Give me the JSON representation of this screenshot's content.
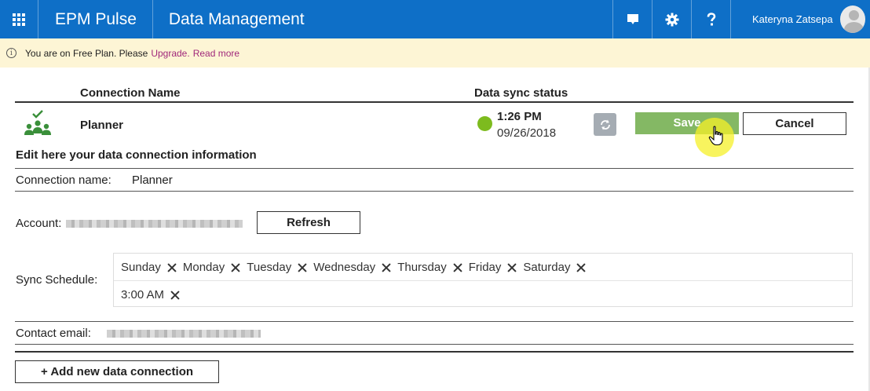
{
  "header": {
    "app_name": "EPM Pulse",
    "page_title": "Data Management",
    "user_name": "Kateryna Zatsepa",
    "icons": [
      "waffle-icon",
      "chat-icon",
      "gear-icon",
      "help-icon",
      "avatar"
    ]
  },
  "banner": {
    "text": "You are on Free Plan. Please",
    "upgrade_link": "Upgrade.",
    "read_more_link": "Read more",
    "info_glyph": "i"
  },
  "table": {
    "col_connection": "Connection Name",
    "col_status": "Data sync status",
    "row": {
      "name": "Planner",
      "sync_time": "1:26 PM",
      "sync_date": "09/26/2018",
      "status_color": "#7dbb1e",
      "save_label": "Save",
      "cancel_label": "Cancel"
    }
  },
  "edit": {
    "title": "Edit here your data connection information",
    "connection_name_label": "Connection name:",
    "connection_name_value": "Planner",
    "account_label": "Account:",
    "refresh_label": "Refresh",
    "sync_schedule_label": "Sync Schedule:",
    "days": [
      "Sunday",
      "Monday",
      "Tuesday",
      "Wednesday",
      "Thursday",
      "Friday",
      "Saturday"
    ],
    "times": [
      "3:00 AM"
    ],
    "contact_email_label": "Contact email:"
  },
  "footer": {
    "add_label": "+ Add new data connection"
  },
  "colors": {
    "brand": "#0e6fc7",
    "banner_bg": "#fdf5d5",
    "link": "#a0287a",
    "save_bg": "#84b864",
    "connection_icon": "#3a8f3a"
  }
}
